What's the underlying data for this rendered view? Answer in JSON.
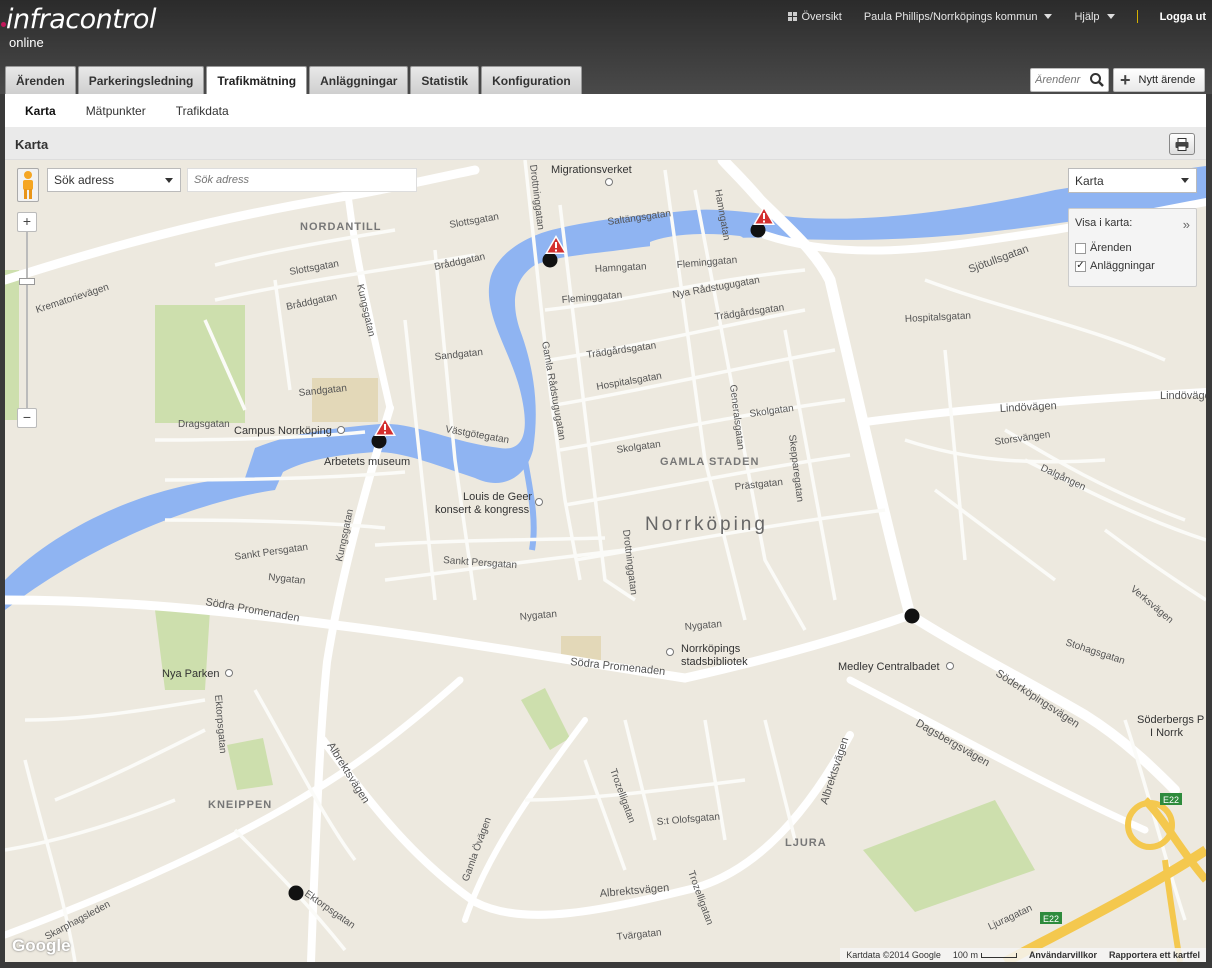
{
  "app": {
    "logo_main": "infracontrol",
    "logo_sub": "online"
  },
  "topnav": {
    "overview": "Översikt",
    "user": "Paula Phillips/Norrköpings kommun",
    "help": "Hjälp",
    "logout": "Logga ut"
  },
  "tabs": [
    {
      "label": "Ärenden"
    },
    {
      "label": "Parkeringsledning"
    },
    {
      "label": "Trafikmätning",
      "active": true
    },
    {
      "label": "Anläggningar"
    },
    {
      "label": "Statistik"
    },
    {
      "label": "Konfiguration"
    }
  ],
  "case_search": {
    "placeholder": "Ärendenr"
  },
  "new_case": {
    "label": "Nytt ärende"
  },
  "subnav": [
    {
      "label": "Karta",
      "active": true
    },
    {
      "label": "Mätpunkter"
    },
    {
      "label": "Trafikdata"
    }
  ],
  "panel": {
    "title": "Karta"
  },
  "map": {
    "address_type": "Sök adress",
    "address_placeholder": "Sök adress",
    "map_type": "Karta",
    "layers": {
      "title": "Visa i karta:",
      "items": [
        {
          "label": "Ärenden",
          "checked": false
        },
        {
          "label": "Anläggningar",
          "checked": true
        }
      ]
    },
    "labels": {
      "nordantill": "NORDANTILL",
      "gamla_staden": "GAMLA STADEN",
      "kneippen": "KNEIPPEN",
      "ljura": "LJURA",
      "city": "Norrköping",
      "migrationsverket": "Migrationsverket",
      "campus": "Campus Norrköping",
      "arbetets": "Arbetets museum",
      "louis1": "Louis de Geer",
      "louis2": "konsert & kongress",
      "stadsbib1": "Norrköpings",
      "stadsbib2": "stadsbibliotek",
      "medley": "Medley Centralbadet",
      "nyaparken": "Nya Parken",
      "soderbergs1": "Söderbergs P",
      "soderbergs2": "I Norrk",
      "kungsgatan": "Kungsgatan",
      "sodra_prom": "Södra Promenaden",
      "soderkopingsvagen": "Söderköpingsvägen",
      "dagsbergsvagen": "Dagsbergsvägen",
      "albrektsvagen": "Albrektsvägen",
      "lindovagen": "Lindövägen",
      "sjotullsgatan": "Sjötullsgatan",
      "hamngatan": "Hamngatan",
      "hospitalsgatan": "Hospitalsgatan",
      "drottninggatan": "Drottninggatan",
      "gamla_radstugugatan": "Gamla Rådstugugatan",
      "tradgardsgatan": "Trädgårdsgatan",
      "skolgatan": "Skolgatan",
      "sandgatan": "Sandgatan",
      "braddgatan": "Bråddgatan",
      "slottsgatan": "Slottsgatan",
      "nygatan": "Nygatan",
      "sankt_persgatan": "Sankt Persgatan",
      "prastgatan": "Prästgatan",
      "gamla_ovagen": "Gamla Övägen",
      "skarphagsleden": "Skarphagsleden",
      "krematorievagen": "Krematorievägen",
      "dragsgatan": "Dragsgatan",
      "vastgotegatan": "Västgötegatan",
      "fleminggatan": "Fleminggatan",
      "nya_radstugugatan": "Nya Rådstugugatan",
      "saltangsgatan": "Saltängsgatan",
      "storsvangen": "Storsvängen",
      "dalgangen": "Dalgången",
      "stohagsgatan": "Stohagsgatan",
      "verksvagen": "Verksvägen",
      "generalsgatan": "Generalsgatan",
      "skepparegatan": "Skepparegatan",
      "st_olofsgatan": "S:t Olofsgatan",
      "trozelligatan": "Trozelligatan",
      "ektorpsgatan": "Ektorpsgatan",
      "tvargatan": "Tvärgatan",
      "ljuragatan": "Ljuragatan",
      "e22": "E22"
    },
    "attribution": {
      "data": "Kartdata ©2014 Google",
      "scale": "100 m",
      "terms": "Användarvillkor",
      "report": "Rapportera ett kartfel"
    },
    "google": "Google"
  },
  "colors": {
    "water": "#8fb4f2",
    "park": "#cddfad",
    "road": "#ffffff",
    "land": "#ede9df",
    "alert": "#d32f2f"
  }
}
